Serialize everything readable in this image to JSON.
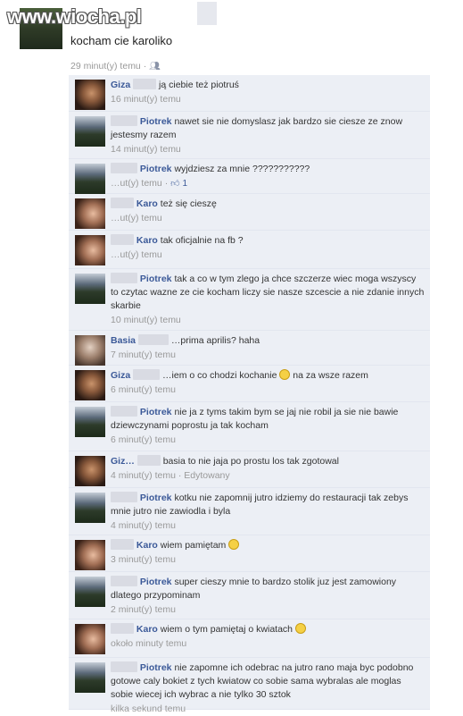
{
  "site_logo": "www.wiocha.pl",
  "post": {
    "text": "kocham cie karoliko",
    "time": "29 minut(y) temu",
    "separator": "·",
    "audience_icon": "people-icon"
  },
  "comments": [
    {
      "author": "Giza",
      "text": "ją ciebie też piotruś",
      "time": "16 minut(y) temu",
      "avatar": "giza"
    },
    {
      "author": "Piotrek",
      "text": "nawet sie nie domyslasz jak bardzo sie ciesze ze znow jestesmy razem",
      "time": "14 minut(y) temu",
      "avatar": "piotrek"
    },
    {
      "author": "Piotrek",
      "text": "wyjdziesz za mnie ???????????",
      "time": "…ut(y) temu",
      "likes": "1",
      "avatar": "piotrek"
    },
    {
      "author": "Karo",
      "text": "też się cieszę",
      "time": "…ut(y) temu",
      "avatar": "karo"
    },
    {
      "author": "Karo",
      "text": "tak oficjalnie na fb ?",
      "time": "…ut(y) temu",
      "avatar": "karo"
    },
    {
      "author": "Piotrek",
      "text": "tak a co w tym zlego ja chce szczerze wiec moga wszyscy to czytac wazne ze cie kocham liczy sie nasze szcescie a nie zdanie innych skarbie",
      "time": "10 minut(y) temu",
      "avatar": "piotrek"
    },
    {
      "author": "Basia",
      "text": "…prima aprilis? haha",
      "time": "7 minut(y) temu",
      "avatar": "basia"
    },
    {
      "author": "Giza",
      "text": "…iem o co chodzi kochanie",
      "text_after": "na za wsze razem",
      "emoji": "smile",
      "time": "6 minut(y) temu",
      "avatar": "giza"
    },
    {
      "author": "Piotrek",
      "text": "nie ja z tyms takim bym se jaj nie robil ja sie nie bawie dziewczynami poprostu ja tak kocham",
      "time": "6 minut(y) temu",
      "avatar": "piotrek"
    },
    {
      "author": "Giz…",
      "text": "basia to nie jaja po prostu los tak zgotowal",
      "time": "4 minut(y) temu · Edytowany",
      "avatar": "giza"
    },
    {
      "author": "Piotrek",
      "text": "kotku nie zapomnij jutro idziemy do restauracji tak zebys mnie jutro nie zawiodla i byla",
      "time": "4 minut(y) temu",
      "avatar": "piotrek"
    },
    {
      "author": "Karo",
      "text": "wiem pamiętam",
      "emoji": "smile",
      "time": "3 minut(y) temu",
      "avatar": "karo"
    },
    {
      "author": "Piotrek",
      "text": "super cieszy mnie to bardzo stolik juz jest zamowiony dlatego przypominam",
      "time": "2 minut(y) temu",
      "avatar": "piotrek"
    },
    {
      "author": "Karo",
      "text": "wiem o tym pamiętaj o kwiatach",
      "emoji": "frown",
      "time": "około minuty temu",
      "avatar": "karo"
    },
    {
      "author": "Piotrek",
      "text": "nie zapomne ich odebrac na jutro rano maja byc podobno gotowe caly bokiet z tych kwiatow co sobie sama wybralas ale moglas sobie wiecej ich wybrac a nie tylko 30 sztok",
      "time": "kilka sekund temu",
      "avatar": "piotrek"
    }
  ]
}
